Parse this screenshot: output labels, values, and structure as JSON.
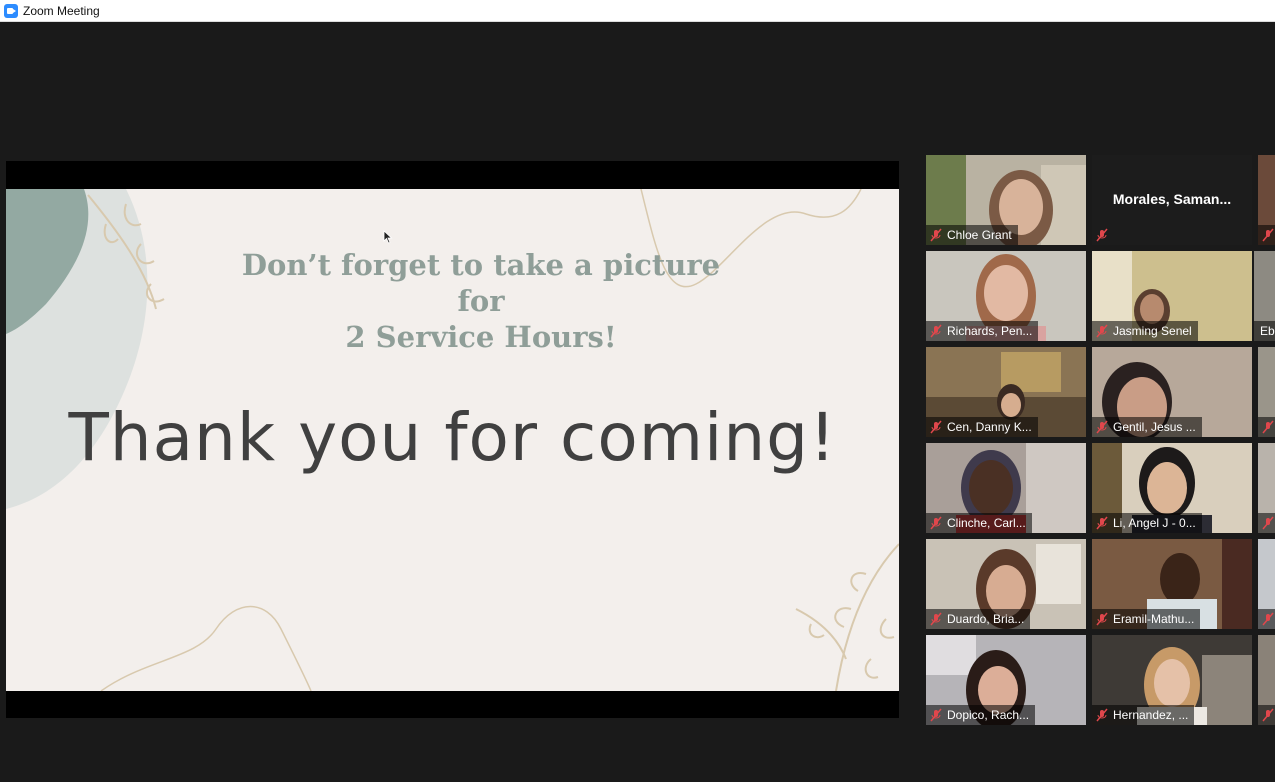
{
  "window": {
    "title": "Zoom Meeting",
    "icon": "zoom-camera-icon"
  },
  "slide": {
    "headline": [
      "Don’t forget to take a picture for",
      "2 Service Hours!"
    ],
    "main_text": "Thank you for coming!"
  },
  "participants": [
    {
      "name": "Chloe Grant",
      "muted": true,
      "video": true
    },
    {
      "name": "Morales,  Saman...",
      "muted": true,
      "video": false
    },
    {
      "name": "Richards, Pen...",
      "muted": true,
      "video": true
    },
    {
      "name": "Jasming Senel",
      "muted": true,
      "video": true
    },
    {
      "name": "Cen, Danny K...",
      "muted": true,
      "video": true
    },
    {
      "name": "Gentil, Jesus ...",
      "muted": true,
      "video": true
    },
    {
      "name": "Clinche, Carl...",
      "muted": true,
      "video": true
    },
    {
      "name": "Li, Angel J - 0...",
      "muted": true,
      "video": true
    },
    {
      "name": "Duardo, Bria...",
      "muted": true,
      "video": true
    },
    {
      "name": "Eramil-Mathu...",
      "muted": true,
      "video": true
    },
    {
      "name": "Dopico, Rach...",
      "muted": true,
      "video": true
    },
    {
      "name": "Hernandez, ...",
      "muted": true,
      "video": true
    }
  ],
  "partial_participant": {
    "name": "Eb"
  },
  "colors": {
    "muted_mic": "#e0474c",
    "zoom_blue": "#2d8cff",
    "active_speaker": "#e5e57a"
  }
}
